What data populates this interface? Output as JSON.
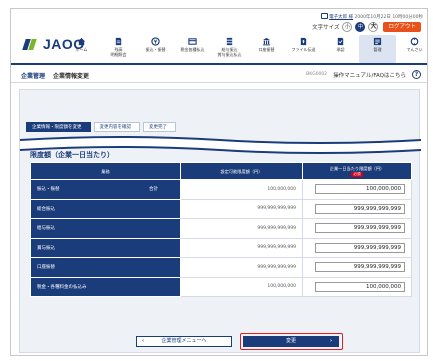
{
  "header": {
    "logo_text": "JAOO",
    "user_name": "電子太郎 様",
    "last_login": "2000年10月22日 10時00分00秒",
    "font_size_label": "文字サイズ",
    "font_small": "小",
    "font_medium": "中",
    "font_large": "大",
    "logout_label": "ログアウト"
  },
  "nav": [
    {
      "label": "ホーム"
    },
    {
      "label": "残高\n明細照会"
    },
    {
      "label": "振込・振替"
    },
    {
      "label": "税金各種払込"
    },
    {
      "label": "給与振込\n賞与振込払込"
    },
    {
      "label": "口座振替"
    },
    {
      "label": "ファイル伝送"
    },
    {
      "label": "承認"
    },
    {
      "label": "管理"
    },
    {
      "label": "でんさい"
    }
  ],
  "titlebar": {
    "breadcrumb": "企業管理",
    "page_title": "企業情報変更",
    "screen_id": "BKG0002",
    "manual_label": "操作マニュアル/FAQはこちら",
    "help_glyph": "?"
  },
  "steps": [
    "企業情報・限度額を変更",
    "変更内容を確認",
    "変更完了"
  ],
  "section_title": "限度額（企業一日当たり）",
  "table": {
    "headers": [
      "業務",
      "設定可能限度額（円）",
      "企業一日当たり限度額（円）"
    ],
    "required_label": "必須",
    "rows": [
      {
        "label": "振込・振替",
        "sub": "合計",
        "max": "100,000,000",
        "value": "100,000,000"
      },
      {
        "label": "総合振込",
        "sub": "",
        "max": "999,999,999,999",
        "value": "999,999,999,999"
      },
      {
        "label": "給与振込",
        "sub": "",
        "max": "999,999,999,999",
        "value": "999,999,999,999"
      },
      {
        "label": "賞与振込",
        "sub": "",
        "max": "999,999,999,999",
        "value": "999,999,999,999"
      },
      {
        "label": "口座振替",
        "sub": "",
        "max": "999,999,999,999",
        "value": "999,999,999,999"
      },
      {
        "label": "税金・各種料金の払込み",
        "sub": "",
        "max": "100,000,000",
        "value": "100,000,000"
      }
    ]
  },
  "buttons": {
    "back": "企業管理メニューへ",
    "back_glyph": "‹",
    "next": "変更",
    "next_glyph": "›"
  }
}
